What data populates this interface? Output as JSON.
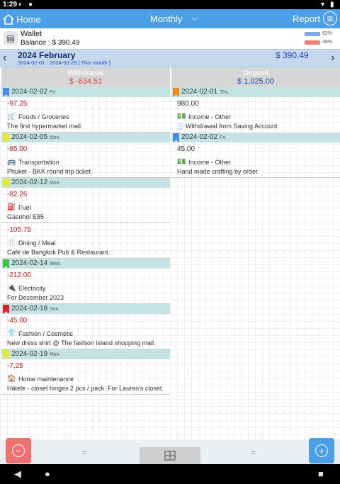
{
  "status": {
    "time": "1:29"
  },
  "appbar": {
    "home_label": "Home",
    "mode_label": "Monthly",
    "report_label": "Report"
  },
  "wallet": {
    "name": "Wallet",
    "balance": "Balance : $ 390.49",
    "withdraw_pct": "62%",
    "deposit_pct": "38%",
    "bar_colors": {
      "blue": "#7fa9e6",
      "red": "#f07c7c"
    }
  },
  "month": {
    "title": "2024 February",
    "range": "2024-02-01 - 2024-02-29 [ This month ]",
    "total": "$ 390.49"
  },
  "withdrawal": {
    "header": "Withdrawal",
    "total": "$ -634.51",
    "groups": [
      {
        "date": "2024-02-02",
        "day": "Fri.",
        "flag_color": "#4b8ce8",
        "entries": [
          {
            "amount": "-97.25",
            "icon": "cart-icon",
            "glyph": "🛒",
            "category": "Foods / Groceries",
            "desc": "The first hypermarket mall."
          }
        ]
      },
      {
        "date": "2024-02-05",
        "day": "Mon.",
        "flag_color": "#e8e82a",
        "entries": [
          {
            "amount": "-85.00",
            "icon": "bus-icon",
            "glyph": "🚌",
            "category": "Transportation",
            "desc": "Phuket - BKK round trip ticket."
          }
        ]
      },
      {
        "date": "2024-02-12",
        "day": "Mon.",
        "flag_color": "#e8e82a",
        "entries": [
          {
            "amount": "-82.26",
            "icon": "fuel-icon",
            "glyph": "⛽",
            "category": "Fuel",
            "desc": "Gasohol E85"
          },
          {
            "amount": "-105.75",
            "icon": "dining-icon",
            "glyph": "🍴",
            "category": "Dining / Meal",
            "desc": "Café de Bangkok Pub & Restaurant."
          }
        ]
      },
      {
        "date": "2024-02-14",
        "day": "Wed.",
        "flag_color": "#3cc04a",
        "entries": [
          {
            "amount": "-212.00",
            "icon": "plug-icon",
            "glyph": "🔌",
            "category": "Electricity",
            "desc": "For December 2023"
          }
        ]
      },
      {
        "date": "2024-02-18",
        "day": "Sun.",
        "flag_color": "#e02020",
        "entries": [
          {
            "amount": "-45.00",
            "icon": "shirt-icon",
            "glyph": "👕",
            "category": "Fashion / Cosmetic",
            "desc": "New dress shirt @ The fashion island shopping mall."
          }
        ]
      },
      {
        "date": "2024-02-19",
        "day": "Mon.",
        "flag_color": "#e8e82a",
        "entries": [
          {
            "amount": "-7.25",
            "icon": "home-maintenance-icon",
            "glyph": "🏠",
            "category": "Home maintenance",
            "desc": "Hätele - closet hinges 2 pcs / pack. For Lauren's closet."
          }
        ]
      }
    ]
  },
  "deposit": {
    "header": "Deposit",
    "total": "$ 1,025.00",
    "groups": [
      {
        "date": "2024-02-01",
        "day": "Thu.",
        "flag_color": "#f08a1e",
        "entries": [
          {
            "amount": "980.00",
            "icon": "money-icon",
            "glyph": "💵",
            "category": "Income - Other",
            "desc": "Withdrawal from Saving Account",
            "desc_icon": "receipt-icon",
            "desc_glyph": "🧾"
          }
        ]
      },
      {
        "date": "2024-02-02",
        "day": "Fri.",
        "flag_color": "#4b8ce8",
        "entries": [
          {
            "amount": "45.00",
            "icon": "money-icon",
            "glyph": "💵",
            "category": "Income - Other",
            "desc": "Hand made crafting by order."
          }
        ]
      }
    ]
  },
  "bottom": {
    "minus_color": "#f07070",
    "plus_color": "#4b9fe8"
  }
}
